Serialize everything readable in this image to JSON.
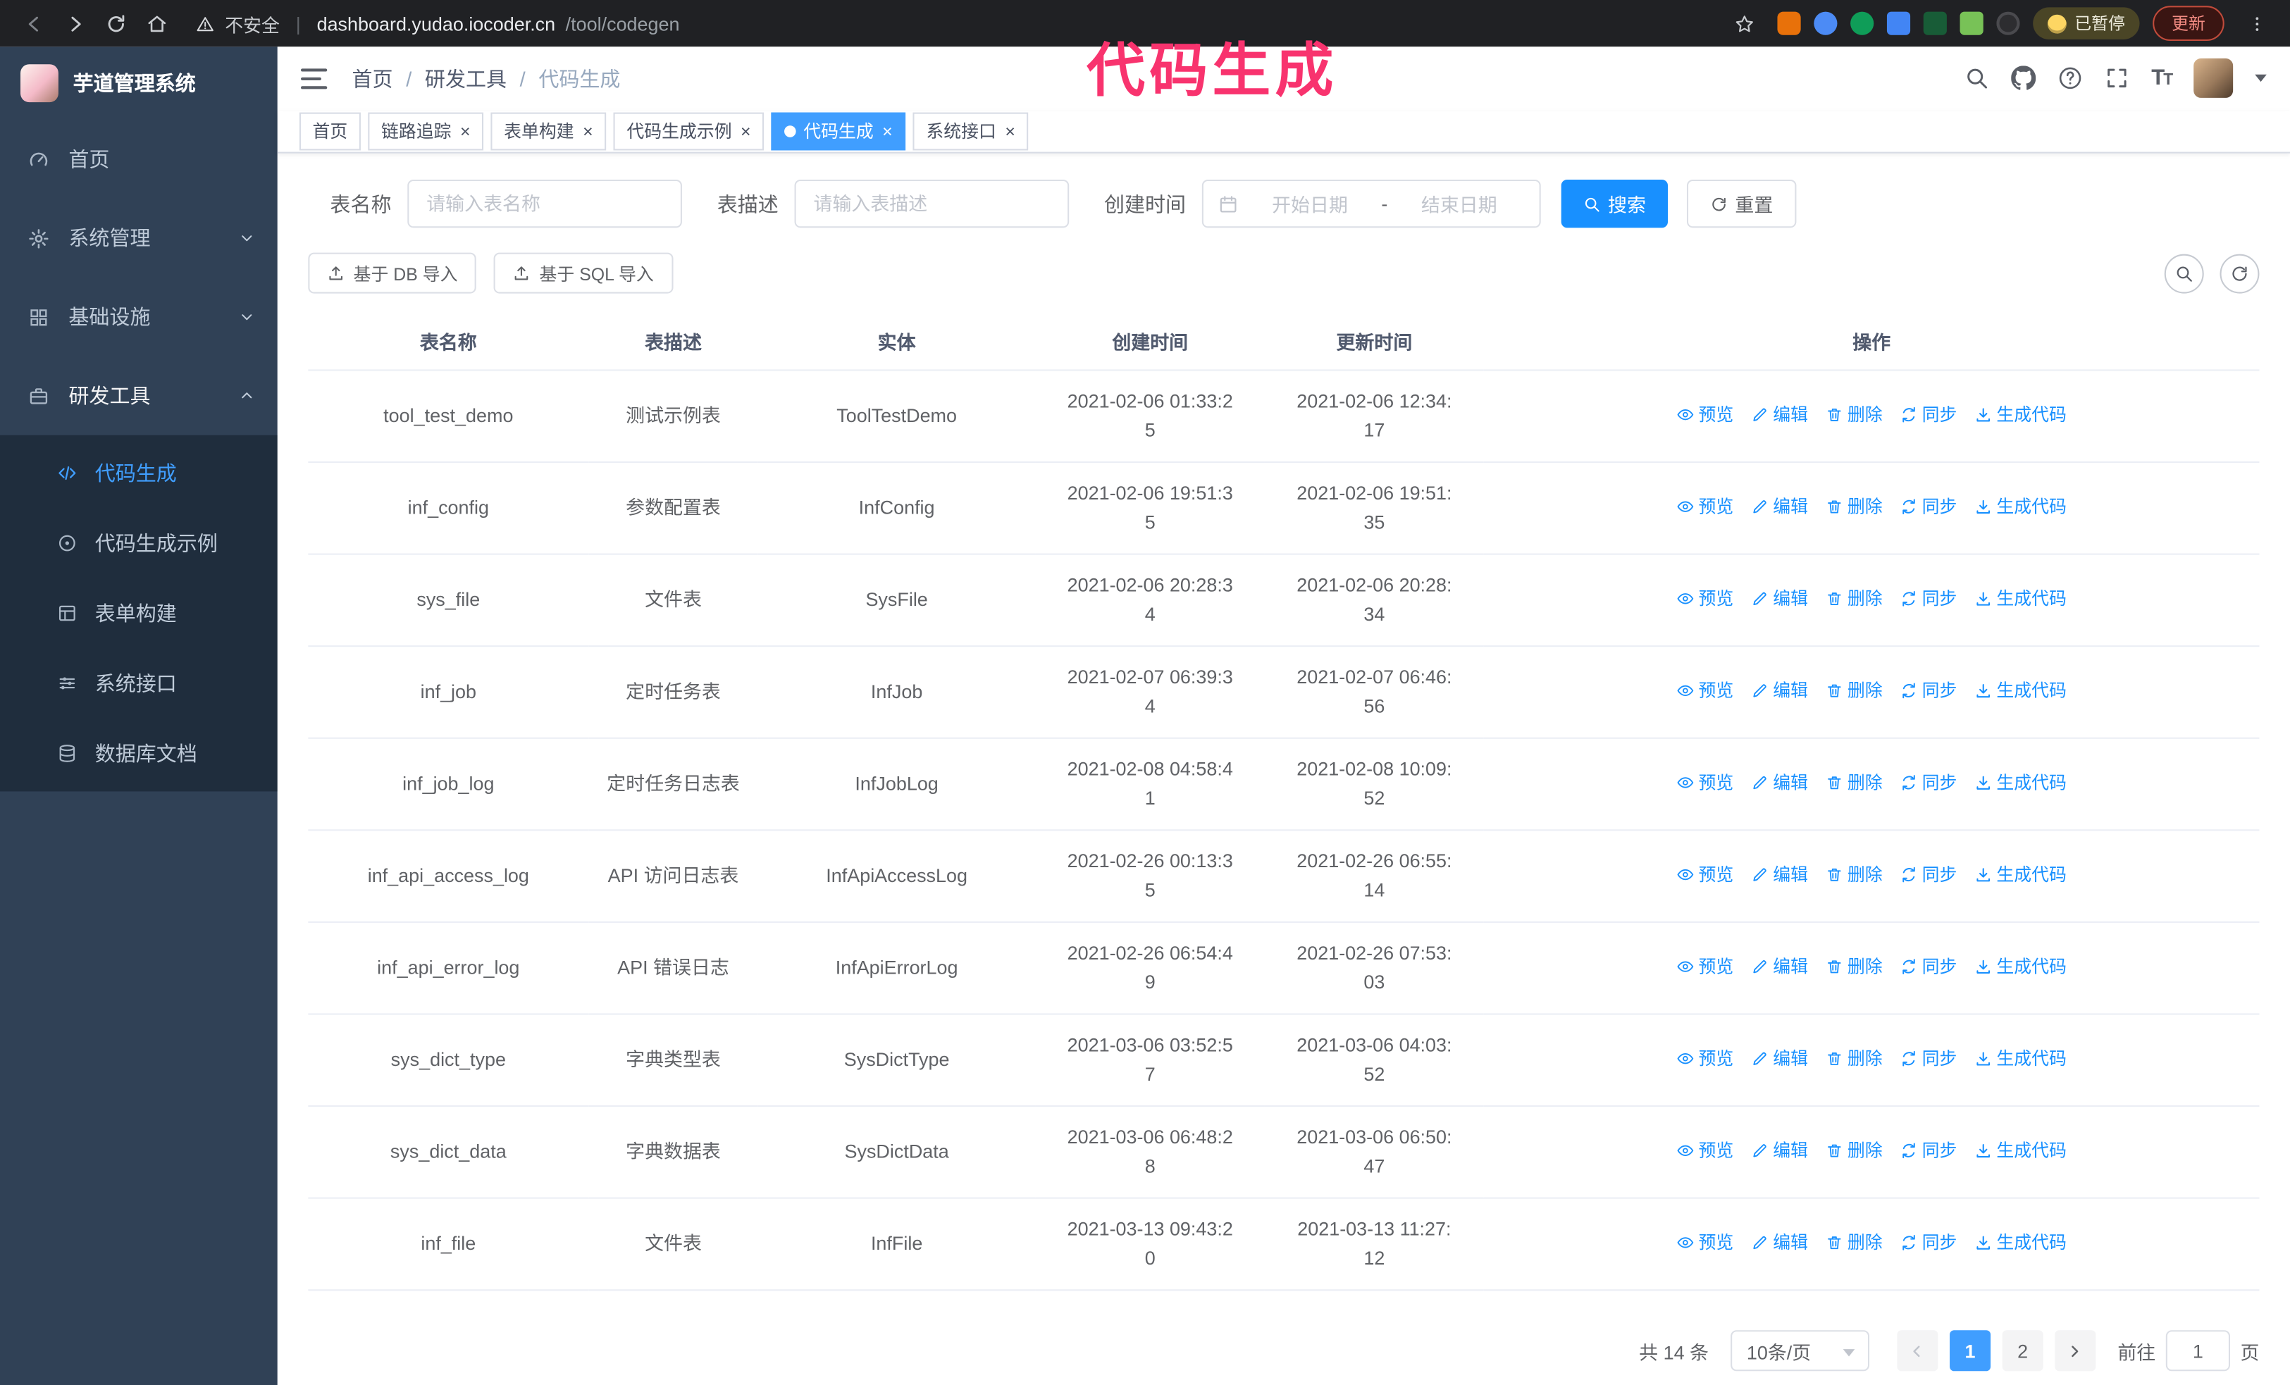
{
  "accent": {
    "primary": "#1890ff",
    "tab_active": "#409eff",
    "annotation": "#f8336e"
  },
  "annotation": {
    "text": "代码生成"
  },
  "browser": {
    "security_warning": "不安全",
    "url_host": "dashboard.yudao.iocoder.cn",
    "url_path": "/tool/codegen",
    "paused_badge": "已暂停",
    "update_button": "更新"
  },
  "sidebar": {
    "logo_title": "芋道管理系统",
    "menu": [
      {
        "key": "home",
        "label": "首页",
        "icon": "dashboard-icon",
        "expandable": false,
        "expanded": false
      },
      {
        "key": "system-management",
        "label": "系统管理",
        "icon": "gear-icon",
        "expandable": true,
        "expanded": false
      },
      {
        "key": "infrastructure",
        "label": "基础设施",
        "icon": "grid-icon",
        "expandable": true,
        "expanded": false
      },
      {
        "key": "dev-tools",
        "label": "研发工具",
        "icon": "tools-icon",
        "expandable": true,
        "expanded": true
      }
    ],
    "submenu": [
      {
        "key": "codegen",
        "label": "代码生成",
        "icon": "code-icon",
        "active": true
      },
      {
        "key": "codegen-example",
        "label": "代码生成示例",
        "icon": "example-icon",
        "active": false
      },
      {
        "key": "form-builder",
        "label": "表单构建",
        "icon": "form-icon",
        "active": false
      },
      {
        "key": "system-api",
        "label": "系统接口",
        "icon": "api-icon",
        "active": false
      },
      {
        "key": "db-doc",
        "label": "数据库文档",
        "icon": "database-icon",
        "active": false
      }
    ]
  },
  "navbar": {
    "breadcrumb": [
      "首页",
      "研发工具",
      "代码生成"
    ]
  },
  "tabs": [
    {
      "key": "home",
      "label": "首页",
      "closable": false,
      "active": false
    },
    {
      "key": "trace",
      "label": "链路追踪",
      "closable": true,
      "active": false
    },
    {
      "key": "form-builder",
      "label": "表单构建",
      "closable": true,
      "active": false
    },
    {
      "key": "codegen-example",
      "label": "代码生成示例",
      "closable": true,
      "active": false
    },
    {
      "key": "codegen",
      "label": "代码生成",
      "closable": true,
      "active": true
    },
    {
      "key": "system-api",
      "label": "系统接口",
      "closable": true,
      "active": false
    }
  ],
  "filters": {
    "table_name_label": "表名称",
    "table_name_placeholder": "请输入表名称",
    "table_desc_label": "表描述",
    "table_desc_placeholder": "请输入表描述",
    "create_time_label": "创建时间",
    "start_date_placeholder": "开始日期",
    "range_separator": "-",
    "end_date_placeholder": "结束日期",
    "search_button": "搜索",
    "reset_button": "重置"
  },
  "toolbar": {
    "import_db_button": "基于 DB 导入",
    "import_sql_button": "基于 SQL 导入"
  },
  "table": {
    "columns": [
      "表名称",
      "表描述",
      "实体",
      "创建时间",
      "更新时间",
      "操作"
    ],
    "ops": [
      {
        "key": "preview",
        "label": "预览",
        "icon": "eye-icon"
      },
      {
        "key": "edit",
        "label": "编辑",
        "icon": "edit-icon"
      },
      {
        "key": "delete",
        "label": "删除",
        "icon": "delete-icon"
      },
      {
        "key": "sync",
        "label": "同步",
        "icon": "sync-icon"
      },
      {
        "key": "generate-code",
        "label": "生成代码",
        "icon": "generate-code-icon"
      }
    ],
    "rows": [
      {
        "name": "tool_test_demo",
        "desc": "测试示例表",
        "entity": "ToolTestDemo",
        "created": "2021-02-06 01:33:25",
        "updated": "2021-02-06 12:34:17"
      },
      {
        "name": "inf_config",
        "desc": "参数配置表",
        "entity": "InfConfig",
        "created": "2021-02-06 19:51:35",
        "updated": "2021-02-06 19:51:35"
      },
      {
        "name": "sys_file",
        "desc": "文件表",
        "entity": "SysFile",
        "created": "2021-02-06 20:28:34",
        "updated": "2021-02-06 20:28:34"
      },
      {
        "name": "inf_job",
        "desc": "定时任务表",
        "entity": "InfJob",
        "created": "2021-02-07 06:39:34",
        "updated": "2021-02-07 06:46:56"
      },
      {
        "name": "inf_job_log",
        "desc": "定时任务日志表",
        "entity": "InfJobLog",
        "created": "2021-02-08 04:58:41",
        "updated": "2021-02-08 10:09:52"
      },
      {
        "name": "inf_api_access_log",
        "desc": "API 访问日志表",
        "entity": "InfApiAccessLog",
        "created": "2021-02-26 00:13:35",
        "updated": "2021-02-26 06:55:14"
      },
      {
        "name": "inf_api_error_log",
        "desc": "API 错误日志",
        "entity": "InfApiErrorLog",
        "created": "2021-02-26 06:54:49",
        "updated": "2021-02-26 07:53:03"
      },
      {
        "name": "sys_dict_type",
        "desc": "字典类型表",
        "entity": "SysDictType",
        "created": "2021-03-06 03:52:57",
        "updated": "2021-03-06 04:03:52"
      },
      {
        "name": "sys_dict_data",
        "desc": "字典数据表",
        "entity": "SysDictData",
        "created": "2021-03-06 06:48:28",
        "updated": "2021-03-06 06:50:47"
      },
      {
        "name": "inf_file",
        "desc": "文件表",
        "entity": "InfFile",
        "created": "2021-03-13 09:43:20",
        "updated": "2021-03-13 11:27:12"
      }
    ]
  },
  "pagination": {
    "total_text": "共 14 条",
    "page_size": "10条/页",
    "pages": [
      "1",
      "2"
    ],
    "active_page": "1",
    "goto_label": "前往",
    "goto_value": "1",
    "goto_suffix": "页"
  }
}
